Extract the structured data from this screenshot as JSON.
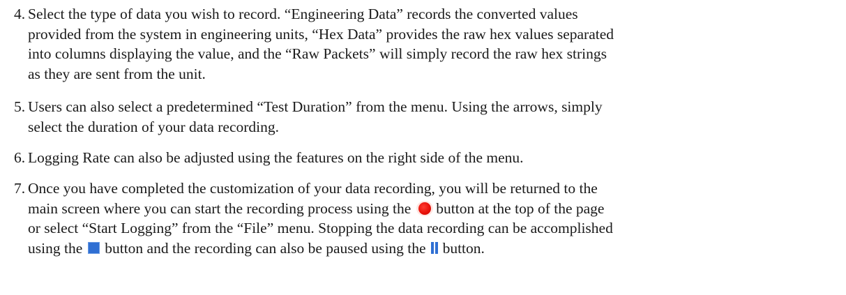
{
  "items": [
    {
      "number": "4.",
      "lines": [
        "Select the type of data you wish to record. “Engineering Data” records the converted values",
        "provided from the system in engineering units, “Hex Data” provides the raw hex values separated",
        "into columns displaying the value, and the “Raw Packets” will simply record the raw hex strings",
        "as they are sent from the unit."
      ]
    },
    {
      "number": "5.",
      "lines": [
        "Users can also select a predetermined “Test Duration” from the menu. Using the arrows, simply",
        "select the duration of your data recording."
      ]
    },
    {
      "number": "6.",
      "lines": [
        "Logging Rate can also be adjusted using the features on the right side of the menu."
      ]
    },
    {
      "number": "7.",
      "line1": "Once you have completed the customization of your data recording, you will be returned to the",
      "line2_before": "main screen where you can start the recording process using the",
      "line2_after": "button at the top of the page",
      "line3": "or select “Start Logging” from the “File” menu. Stopping the data recording can be accomplished",
      "line4_before": "using the",
      "line4_middle": "button and the recording can also be paused using the",
      "line4_after": "button."
    }
  ],
  "icons": {
    "record": "record-icon",
    "stop": "stop-icon",
    "pause": "pause-icon",
    "record_color": "#e8120a",
    "stop_color": "#2f6fd3",
    "pause_color": "#2f6fd3"
  }
}
